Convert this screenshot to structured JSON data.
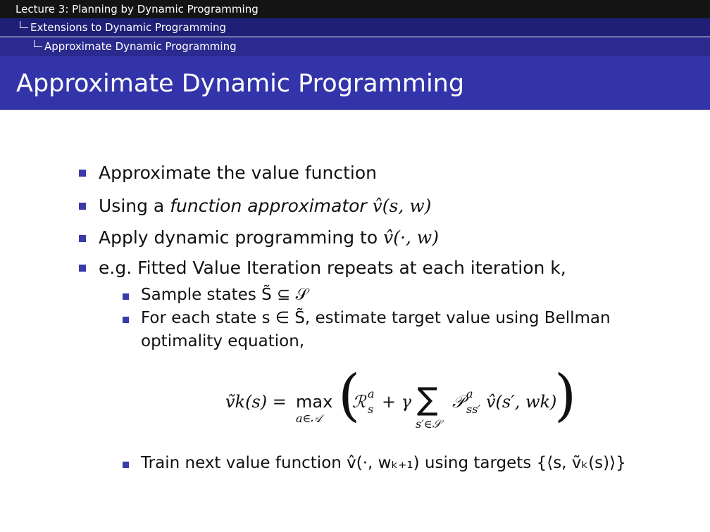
{
  "nav": {
    "lecture": "Lecture 3: Planning by Dynamic Programming",
    "section": "Extensions to Dynamic Programming",
    "subsection": "Approximate Dynamic Programming"
  },
  "slide": {
    "title": "Approximate Dynamic Programming",
    "bullets": {
      "b1": "Approximate the value function",
      "b2_prefix": "Using a ",
      "b2_italic": "function approximator",
      "b2_math": "v̂(s, w)",
      "b3_prefix": "Apply dynamic programming to ",
      "b3_math": "v̂(·, w)",
      "b4": "e.g. Fitted Value Iteration repeats at each iteration k,"
    },
    "subbullets": {
      "s1": "Sample states S̃ ⊆ 𝒮",
      "s2_line1": "For each state s ∈ S̃, estimate target value using Bellman",
      "s2_line2": "optimality equation,",
      "s3": "Train next value function v̂(·, wₖ₊₁) using targets {⟨s, ṽₖ(s)⟩}"
    },
    "equation": {
      "lhs": "ṽk(s) = ",
      "max": "max",
      "max_sub": "a∈𝒜",
      "open_paren": "(",
      "R": "ℛ",
      "R_sup": "a",
      "R_sub": "s",
      "plus_gamma": "+ γ",
      "sum": "∑",
      "sum_sub": "s′∈𝒮",
      "P": "𝒫",
      "P_sup": "a",
      "P_sub": "ss′",
      "term": "v̂(s′, wk)",
      "close_paren": ")"
    }
  }
}
